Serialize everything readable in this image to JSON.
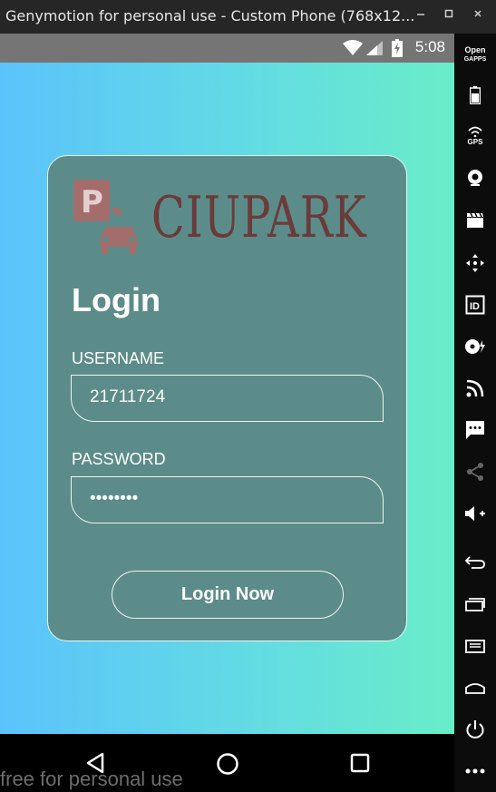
{
  "window": {
    "title": "Genymotion for personal use - Custom Phone (768x12...",
    "minimize_icon": "minimize-icon",
    "maximize_icon": "maximize-icon",
    "close_icon": "close-icon"
  },
  "status_bar": {
    "time": "5:08",
    "icons": [
      "wifi-icon",
      "signal-icon",
      "battery-icon"
    ]
  },
  "login": {
    "logo_text": "CIUPARK",
    "title": "Login",
    "username_label": "USERNAME",
    "username_value": "21711724",
    "password_label": "PASSWORD",
    "password_value": "••••••••",
    "button_label": "Login Now"
  },
  "nav": {
    "icons": [
      "back-icon",
      "home-icon",
      "recents-icon"
    ]
  },
  "watermark": "free for personal use",
  "sidebar": {
    "top_label_1": "Open",
    "top_label_2": "GAPPS",
    "gps_label": "GPS",
    "icons": [
      "open-gapps-icon",
      "battery-icon",
      "gps-icon",
      "webcam-icon",
      "clapper-icon",
      "dpad-icon",
      "identifier-icon",
      "disk-icon",
      "cast-icon",
      "sms-icon",
      "share-icon",
      "volume-up-icon",
      "back-icon",
      "recents-icon",
      "menu-icon",
      "home-icon",
      "power-icon",
      "more-icon"
    ]
  },
  "colors": {
    "gradient_left": "#5bc3fb",
    "gradient_right": "#69edc8",
    "card": "#5c8c89",
    "logo": "#6b3b3b"
  }
}
